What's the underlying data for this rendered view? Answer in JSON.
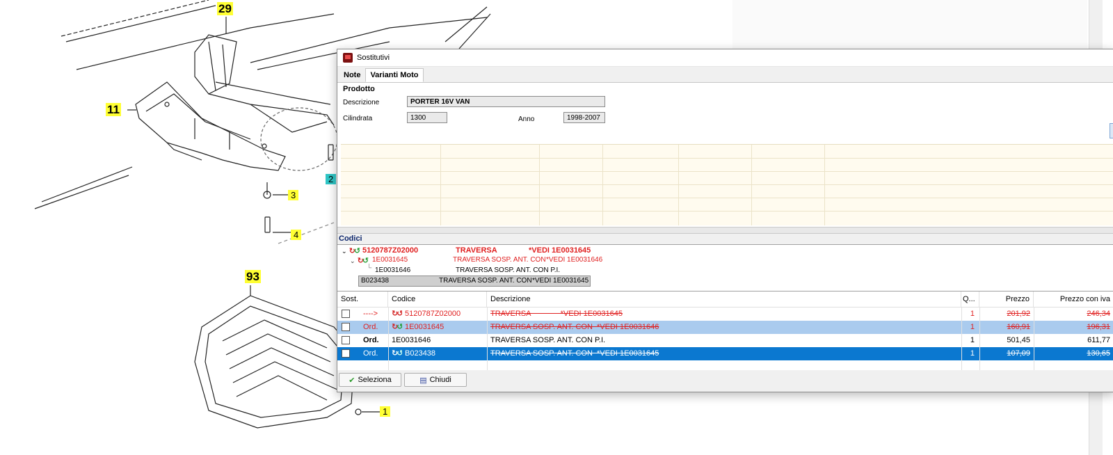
{
  "drawing": {
    "callouts": {
      "c29": "29",
      "c11": "11",
      "c3": "3",
      "c4": "4",
      "c2": "2",
      "c93": "93",
      "c1": "1"
    }
  },
  "dialog": {
    "title": "Sostitutivi",
    "tabs": [
      {
        "label": "Note"
      },
      {
        "label": "Varianti Moto"
      }
    ],
    "prodotto": {
      "group_label": "Prodotto",
      "descrizione_label": "Descrizione",
      "descrizione_value": "PORTER 16V VAN",
      "cilindrata_label": "Cilindrata",
      "cilindrata_value": "1300",
      "anno_label": "Anno",
      "anno_value": "1998-2007"
    },
    "codici": {
      "label": "Codici",
      "tree": [
        {
          "code": "5120787Z02000",
          "desc": "TRAVERSA",
          "note": "*VEDI 1E0031645"
        },
        {
          "code": "1E0031645",
          "desc": "TRAVERSA SOSP. ANT. CON",
          "note": "*VEDI 1E0031646"
        },
        {
          "code": "1E0031646",
          "desc": "TRAVERSA SOSP. ANT. CON P.I.",
          "note": ""
        },
        {
          "code": "B023438",
          "desc": "TRAVERSA SOSP. ANT. CON",
          "note": "*VEDI 1E0031645"
        }
      ]
    },
    "table": {
      "headers": {
        "sost": "Sost.",
        "codice": "Codice",
        "descrizione": "Descrizione",
        "qty": "Q...",
        "prezzo": "Prezzo",
        "prezzo_iva": "Prezzo con iva"
      },
      "rows": [
        {
          "ord": "---->",
          "codice": "5120787Z02000",
          "descrizione": "TRAVERSA              *VEDI 1E0031645",
          "qty": "1",
          "prezzo": "201,92",
          "prezzo_iva": "246,34"
        },
        {
          "ord": "Ord.",
          "codice": "1E0031645",
          "descrizione": "TRAVERSA SOSP. ANT. CON  *VEDI 1E0031646",
          "qty": "1",
          "prezzo": "160,91",
          "prezzo_iva": "196,31"
        },
        {
          "ord": "Ord.",
          "codice": "1E0031646",
          "descrizione": "TRAVERSA SOSP. ANT. CON P.I.",
          "qty": "1",
          "prezzo": "501,45",
          "prezzo_iva": "611,77"
        },
        {
          "ord": "Ord.",
          "codice": "B023438",
          "descrizione": "TRAVERSA SOSP. ANT. CON  *VEDI 1E0031645",
          "qty": "1",
          "prezzo": "107,09",
          "prezzo_iva": "130,65"
        }
      ]
    },
    "buttons": {
      "seleziona": "Seleziona",
      "chiudi": "Chiudi"
    }
  },
  "colors": {
    "accent_blue": "#0b78d0",
    "selection_light": "#aacbee",
    "obsolete_red": "#e02020",
    "callout_yellow": "#ffff33",
    "callout_cyan": "#2fc6c6"
  }
}
